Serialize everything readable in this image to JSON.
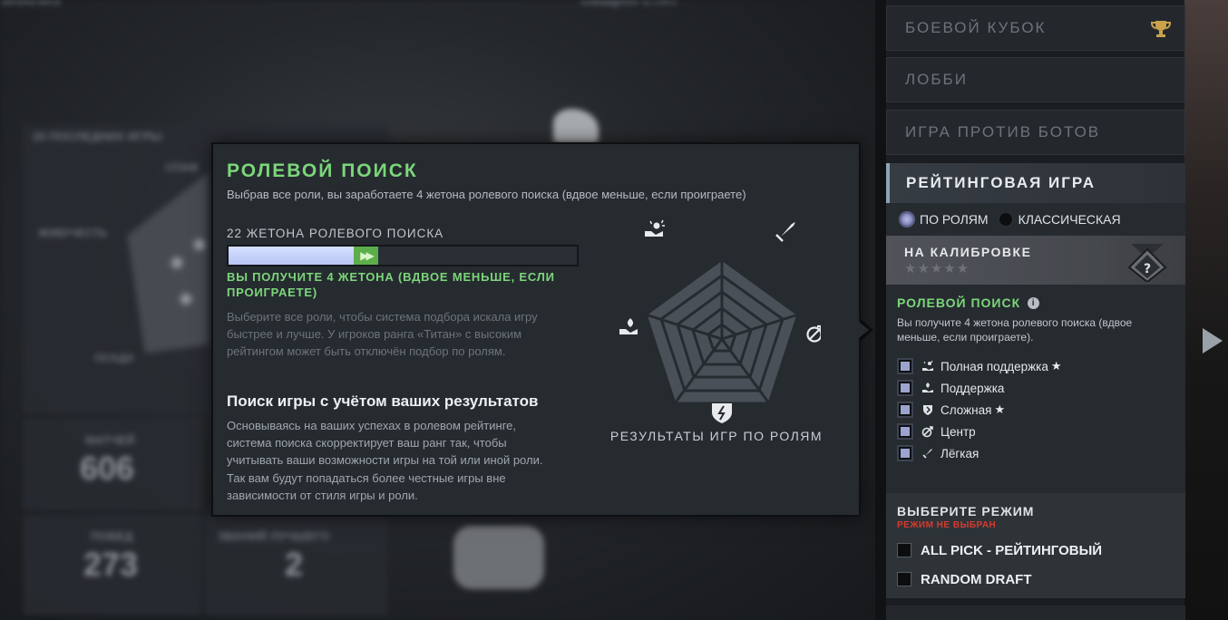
{
  "background": {
    "top_label_left": "ЭНАЛИЗ",
    "top_label_center": "ОБЩАЯ СТАТ",
    "last_games": "20 ПОСЛЕДНИХ ИГРЫ",
    "matches_label": "МАТЧЕЙ",
    "matches_value": "606",
    "wins_label": "ПОБЕД",
    "wins_value": "273",
    "best_label": "ЗВАНИЙ ЛУЧШЕГО",
    "best_value": "2",
    "side_label_1": "СПАМ",
    "side_label_2": "ЖИВУЧЕСТЬ",
    "side_label_3": "ОСАДА"
  },
  "menu": {
    "battle_cup": "БОЕВОЙ КУБОК",
    "lobby": "ЛОББИ",
    "bots": "ИГРА ПРОТИВ БОТОВ",
    "ranked": "РЕЙТИНГОВАЯ ИГРА"
  },
  "ranked": {
    "radio_roles": "ПО РОЛЯМ",
    "radio_classic": "КЛАССИЧЕСКАЯ",
    "calibration_title": "НА КАЛИБРОВКЕ",
    "calibration_stars": "★★★★★",
    "role_search_title": "РОЛЕВОЙ ПОИСК",
    "role_search_desc": "Вы получите 4 жетона ролевого поиска (вдвое меньше, если проиграете).",
    "roles": [
      {
        "label": "Полная поддержка",
        "star": "★",
        "icon": "hard-support-icon"
      },
      {
        "label": "Поддержка",
        "star": "",
        "icon": "support-icon"
      },
      {
        "label": "Сложная",
        "star": "★",
        "icon": "offlane-icon"
      },
      {
        "label": "Центр",
        "star": "",
        "icon": "mid-icon"
      },
      {
        "label": "Лёгкая",
        "star": "",
        "icon": "safelane-icon"
      }
    ],
    "mode_title": "ВЫБЕРИТЕ РЕЖИМ",
    "mode_warning": "РЕЖИМ НЕ ВЫБРАН",
    "modes": [
      "ALL PICK - РЕЙТИНГОВЫЙ",
      "RANDOM DRAFT"
    ]
  },
  "tooltip": {
    "title": "РОЛЕВОЙ ПОИСК",
    "subtitle": "Выбрав все роли, вы заработаете 4 жетона ролевого поиска (вдвое меньше, если проиграете)",
    "tokens_label": "22 ЖЕТОНА РОЛЕВОГО ПОИСКА",
    "progress_fraction": 0.36,
    "gain_fraction": 0.07,
    "gain_arrows": "▶▶",
    "gain_text": "ВЫ ПОЛУЧИТЕ 4 ЖЕТОНА (ВДВОЕ МЕНЬШЕ, ЕСЛИ ПРОИГРАЕТЕ)",
    "gray_text": "Выберите все роли, чтобы система подбора искала игру быстрее и лучше. У игроков ранга «Титан» с высоким рейтингом может быть отключён подбор по ролям.",
    "heading": "Поиск игры с учётом ваших результатов",
    "body_text": "Основываясь на ваших успехах в ролевом рейтинге, система поиска скорректирует ваш ранг так, чтобы учитывать ваши возможности игры на той или иной роли. Так вам будут попадаться более честные игры вне зависимости от стиля игры и роли.",
    "radar_caption": "РЕЗУЛЬТАТЫ ИГР ПО РОЛЯМ"
  },
  "colors": {
    "accent_green": "#7cd67a",
    "warning_red": "#d63b2f",
    "progress_blue": "#c6d1fa",
    "gain_green": "#5cae4b"
  }
}
